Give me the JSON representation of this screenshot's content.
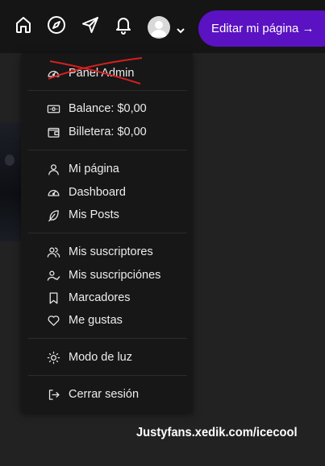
{
  "topbar": {
    "icons": [
      "home-icon",
      "compass-icon",
      "send-icon",
      "bell-icon"
    ],
    "edit_button_label": "Editar mi página →",
    "accent_color": "#5b12c2"
  },
  "menu": {
    "items": [
      {
        "label": "Panel Admin",
        "icon": "gauge-icon",
        "struck_out": true
      },
      {
        "label": "Balance: $0,00",
        "icon": "banknote-icon"
      },
      {
        "label": "Billetera: $0,00",
        "icon": "wallet-icon"
      },
      {
        "label": "Mi página",
        "icon": "user-icon"
      },
      {
        "label": "Dashboard",
        "icon": "gauge-icon"
      },
      {
        "label": "Mis Posts",
        "icon": "feather-icon"
      },
      {
        "label": "Mis suscriptores",
        "icon": "users-icon"
      },
      {
        "label": "Mis suscripciónes",
        "icon": "user-check-icon"
      },
      {
        "label": "Marcadores",
        "icon": "bookmark-icon"
      },
      {
        "label": "Me gustas",
        "icon": "heart-icon"
      },
      {
        "label": "Modo de luz",
        "icon": "sun-icon"
      },
      {
        "label": "Cerrar sesión",
        "icon": "logout-icon"
      }
    ],
    "strike_color": "#d42020"
  },
  "watermark": "Justyfans.xedik.com/icecool"
}
